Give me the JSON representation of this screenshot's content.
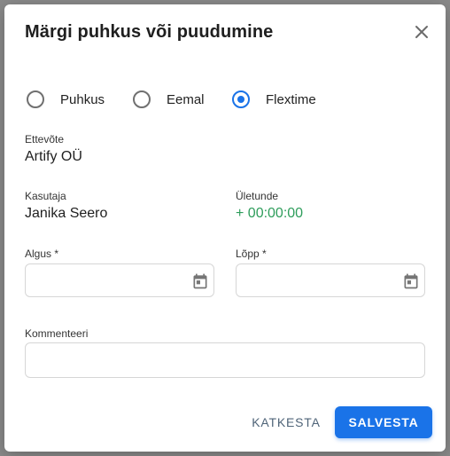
{
  "dialog": {
    "title": "Märgi puhkus või puudumine",
    "close_icon": "close-icon"
  },
  "absence_type": {
    "options": [
      "Puhkus",
      "Eemal",
      "Flextime"
    ],
    "selected": "Flextime"
  },
  "company": {
    "label": "Ettevõte",
    "value": "Artify OÜ"
  },
  "user": {
    "label": "Kasutaja",
    "value": "Janika Seero"
  },
  "overtime": {
    "label": "Ületunde",
    "value": "+ 00:00:00",
    "color": "#2e9d5b"
  },
  "start": {
    "label": "Algus *",
    "value": "",
    "icon": "calendar-icon"
  },
  "end": {
    "label": "Lõpp *",
    "value": "",
    "icon": "calendar-icon"
  },
  "comment": {
    "label": "Kommenteeri",
    "value": ""
  },
  "actions": {
    "cancel": "KATKESTA",
    "save": "SALVESTA"
  },
  "colors": {
    "accent": "#1a73e8",
    "overlay": "#8a8a8a"
  }
}
